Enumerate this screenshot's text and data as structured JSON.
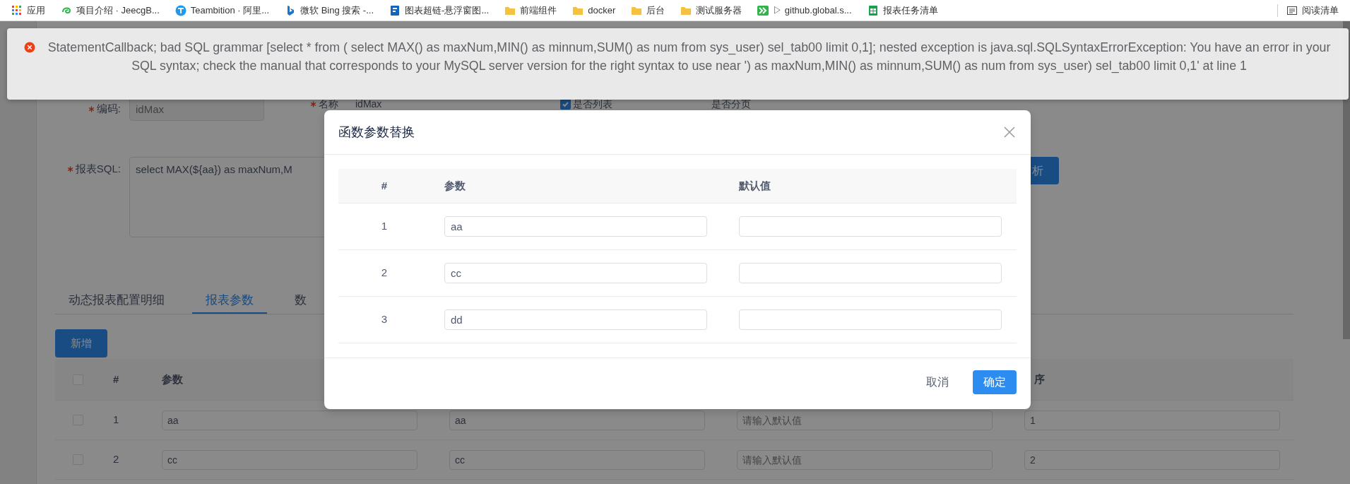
{
  "bookmarks": [
    {
      "kind": "apps",
      "label": "应用"
    },
    {
      "kind": "swirl",
      "label": "项目介绍 · JeecgB..."
    },
    {
      "kind": "circle",
      "label": "Teambition · 阿里..."
    },
    {
      "kind": "ribbon",
      "label": "微软 Bing 搜索 -..."
    },
    {
      "kind": "document",
      "label": "图表超链-悬浮窗图..."
    },
    {
      "kind": "folder",
      "label": "前端组件"
    },
    {
      "kind": "folder",
      "label": "docker"
    },
    {
      "kind": "folder",
      "label": "后台"
    },
    {
      "kind": "folder",
      "label": "测试服务器"
    },
    {
      "kind": "chevrons",
      "label": "▷ github.global.s..."
    },
    {
      "kind": "sheet",
      "label": "报表任务清单"
    }
  ],
  "reading_list": {
    "label": "阅读清单"
  },
  "error_message": {
    "text": "StatementCallback; bad SQL grammar [select * from ( select MAX() as maxNum,MIN() as minnum,SUM() as num from sys_user) sel_tab00 limit 0,1]; nested exception is java.sql.SQLSyntaxErrorException: You have an error in your SQL syntax; check the manual that corresponds to your MySQL server version for the right syntax to use near ') as maxNum,MIN() as minnum,SUM() as num from sys_user) sel_tab00 limit 0,1' at line 1"
  },
  "form": {
    "fields": [
      {
        "label": "编码:",
        "required": true,
        "value": "idMax",
        "disabled": true
      },
      {
        "label": "名称",
        "required": true,
        "value": "idMax",
        "disabled": false
      }
    ],
    "list_flag": {
      "label": "是否列表",
      "checked": true
    },
    "paging_label": "是否分页",
    "sql": {
      "label": "报表SQL:",
      "required": true,
      "value": "select MAX(${aa}) as maxNum,M"
    },
    "parse_button": "析"
  },
  "tabs": [
    {
      "label": "动态报表配置明细",
      "selected": false
    },
    {
      "label": "报表参数",
      "selected": true
    },
    {
      "label": "数",
      "selected": false
    }
  ],
  "add_button": "新增",
  "param_table": {
    "select_all_checked": false,
    "columns": [
      "#",
      "参数",
      "序"
    ],
    "rows": [
      {
        "checked": false,
        "index": "1",
        "param": "aa",
        "name": "aa",
        "default_placeholder": "请输入默认值",
        "order": "1"
      },
      {
        "checked": false,
        "index": "2",
        "param": "cc",
        "name": "cc",
        "default_placeholder": "请输入默认值",
        "order": "2"
      }
    ]
  },
  "dialog": {
    "title": "函数参数替换",
    "columns": [
      "#",
      "参数",
      "默认值"
    ],
    "rows": [
      {
        "index": "1",
        "param": "aa"
      },
      {
        "index": "2",
        "param": "cc"
      },
      {
        "index": "3",
        "param": "dd"
      }
    ],
    "cancel": "取消",
    "ok": "确定"
  }
}
